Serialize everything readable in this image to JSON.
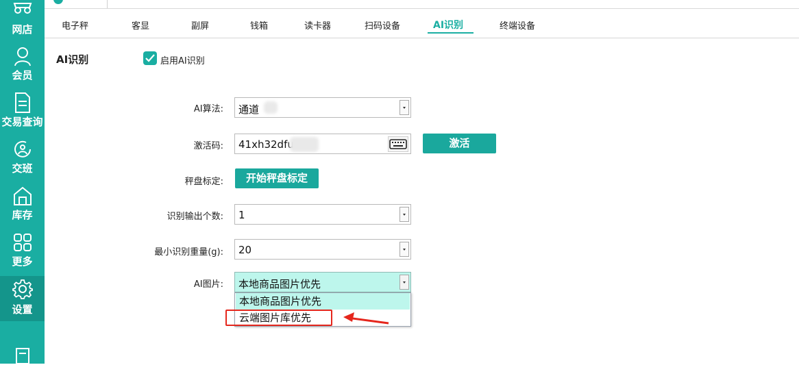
{
  "sidebar": {
    "items": [
      {
        "label": "网店",
        "icon": "store-icon"
      },
      {
        "label": "会员",
        "icon": "member-icon"
      },
      {
        "label": "交易查询",
        "icon": "transaction-query-icon"
      },
      {
        "label": "交班",
        "icon": "shift-handover-icon"
      },
      {
        "label": "库存",
        "icon": "inventory-icon"
      },
      {
        "label": "更多",
        "icon": "more-grid-icon"
      },
      {
        "label": "设置",
        "icon": "settings-gear-icon",
        "active": true
      }
    ]
  },
  "tabs": [
    {
      "label": "电子秤"
    },
    {
      "label": "客显"
    },
    {
      "label": "副屏"
    },
    {
      "label": "钱箱"
    },
    {
      "label": "读卡器"
    },
    {
      "label": "扫码设备"
    },
    {
      "label": "AI识别",
      "active": true
    },
    {
      "label": "终端设备"
    }
  ],
  "section": {
    "title": "AI识别",
    "enable_label": "启用AI识别",
    "enabled": true
  },
  "form": {
    "algorithm": {
      "label": "AI算法:",
      "value": "通道"
    },
    "activation": {
      "label": "激活码:",
      "value": "41xh32dfu",
      "button": "激活"
    },
    "calibration": {
      "label": "秤盘标定:",
      "button": "开始秤盘标定"
    },
    "output_count": {
      "label": "识别输出个数:",
      "value": "1"
    },
    "min_weight": {
      "label": "最小识别重量(g):",
      "value": "20"
    },
    "ai_image": {
      "label": "AI图片:",
      "value": "本地商品图片优先",
      "options": [
        "本地商品图片优先",
        "云端图片库优先"
      ]
    }
  },
  "colors": {
    "brand": "#1aaea2",
    "active_nav": "#14958b",
    "selected_option": "#bdf6ec",
    "annotation": "#e5261c"
  }
}
